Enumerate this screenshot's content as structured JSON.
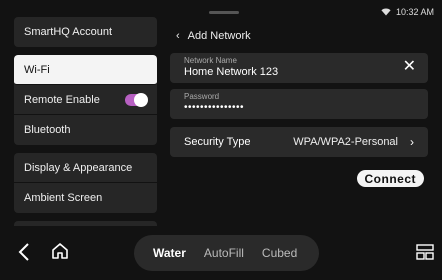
{
  "status": {
    "time": "10:32 AM",
    "wifi_icon": "wifi-icon"
  },
  "menu": {
    "groups": [
      [
        {
          "label": "SmartHQ Account"
        }
      ],
      [
        {
          "label": "Wi-Fi",
          "selected": true
        },
        {
          "label": "Remote Enable",
          "toggle": true,
          "toggle_on": true
        },
        {
          "label": "Bluetooth"
        }
      ],
      [
        {
          "label": "Display & Appearance"
        },
        {
          "label": "Ambient Screen"
        }
      ]
    ]
  },
  "panel": {
    "back_label": "Add Network",
    "network_name": {
      "label": "Network Name",
      "value": "Home Network 123"
    },
    "password": {
      "label": "Password",
      "value": "•••••••••••••••"
    },
    "security": {
      "label": "Security Type",
      "value": "WPA/WPA2-Personal"
    },
    "connect_label": "Connect"
  },
  "bottom": {
    "modes": [
      {
        "label": "Water",
        "active": true
      },
      {
        "label": "AutoFill",
        "active": false
      },
      {
        "label": "Cubed",
        "active": false
      }
    ]
  },
  "colors": {
    "toggle_accent": "#b760c2",
    "background": "#121212",
    "card": "#262626"
  }
}
